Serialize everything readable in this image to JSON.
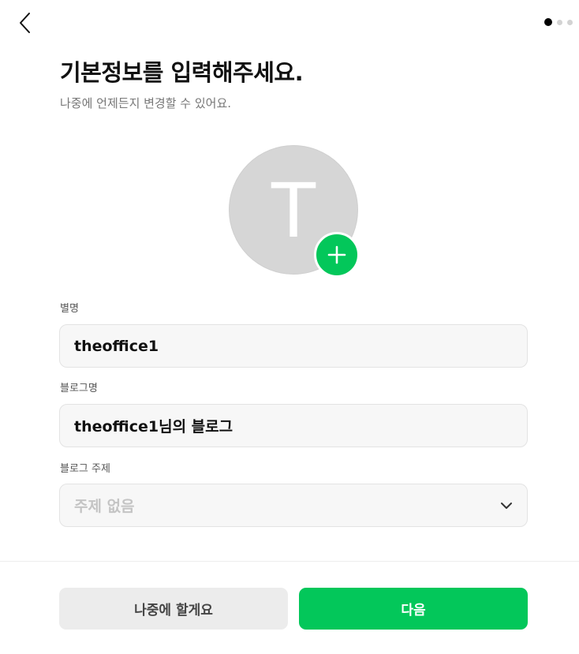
{
  "header": {
    "back_icon": "chevron-left-icon",
    "pager": {
      "total": 3,
      "current": 1
    }
  },
  "intro": {
    "title": "기본정보를 입력해주세요.",
    "subtitle": "나중에 언제든지 변경할 수 있어요."
  },
  "profile": {
    "avatar_initial": "T",
    "add_icon": "plus-icon",
    "accent_color": "#03c75a"
  },
  "form": {
    "nickname": {
      "label": "별명",
      "value": "theoffice1"
    },
    "blog_name": {
      "label": "블로그명",
      "value": "theoffice1님의 블로그"
    },
    "blog_topic": {
      "label": "블로그 주제",
      "selected": "주제 없음",
      "icon": "chevron-down-icon"
    }
  },
  "footer": {
    "later_label": "나중에 할게요",
    "next_label": "다음"
  }
}
